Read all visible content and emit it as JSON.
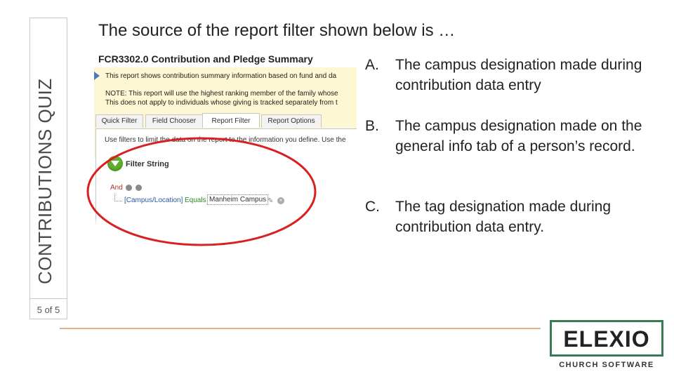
{
  "sidebar": {
    "title": "CONTRIBUTIONS QUIZ",
    "page_count": "5 of 5"
  },
  "question": "The source of the report filter shown below is …",
  "screenshot": {
    "report_title": "FCR3302.0 Contribution and Pledge Summary",
    "info_line_1": "This report shows contribution summary information based on fund and da",
    "note_line_1": "NOTE: This report will use the highest ranking member of the family whose",
    "note_line_2": "This does not apply to individuals whose giving is tracked separately from t",
    "tabs": [
      "Quick Filter",
      "Field Chooser",
      "Report Filter",
      "Report Options"
    ],
    "active_tab": 2,
    "panel_description": "Use filters to limit the data on the report to the information you define. Use the",
    "filter_string_label": "Filter String",
    "and_label": "And",
    "condition_field": "[Campus/Location]",
    "condition_operator": "Equals",
    "condition_value": "Manheim Campus"
  },
  "answers": [
    {
      "letter": "A.",
      "text": "The campus designation made during contribution data entry"
    },
    {
      "letter": "B.",
      "text": "The campus designation made on the general info tab of a person’s record."
    },
    {
      "letter": "C.",
      "text": "The tag designation made during contribution data entry."
    }
  ],
  "logo": {
    "word": "ELEXIO",
    "subtitle": "CHURCH SOFTWARE"
  },
  "colors": {
    "highlight_circle": "#d92020",
    "logo_border": "#3a7a55",
    "rule": "#e0b38f",
    "note_background": "#fdf8d3"
  }
}
